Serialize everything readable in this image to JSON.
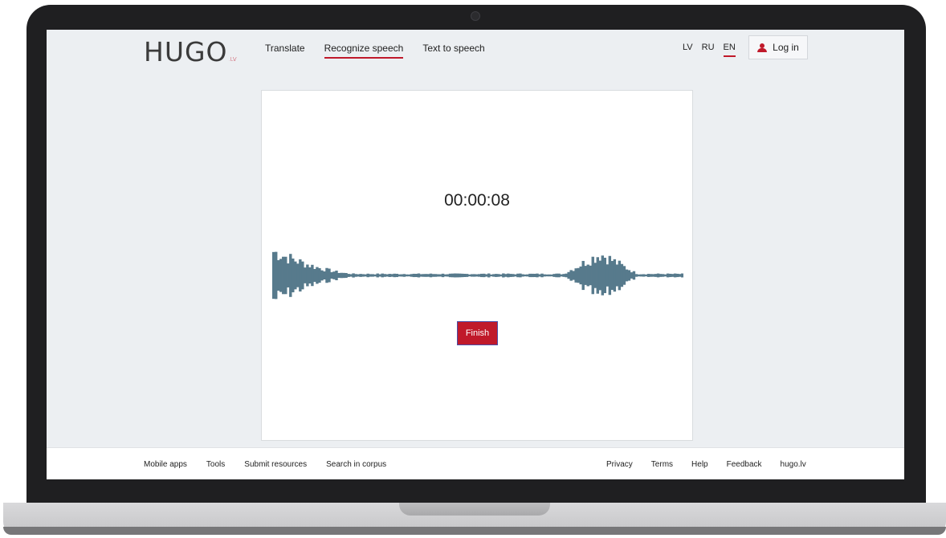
{
  "header": {
    "logo_main": "HUGO",
    "logo_sub": ".LV",
    "nav": [
      "Translate",
      "Recognize speech",
      "Text to speech"
    ],
    "active_nav": "Recognize speech",
    "languages": [
      "LV",
      "RU",
      "EN"
    ],
    "active_language": "EN",
    "login_label": "Log in"
  },
  "recorder": {
    "elapsed": "00:00:08",
    "finish_label": "Finish"
  },
  "footer": {
    "left_links": [
      "Mobile apps",
      "Tools",
      "Submit resources",
      "Search in corpus"
    ],
    "right_links": [
      "Privacy",
      "Terms",
      "Help",
      "Feedback",
      "hugo.lv"
    ]
  },
  "colors": {
    "accent": "#c0192a",
    "waveform": "#577a8c",
    "screen_bg": "#eceff2"
  },
  "icons": {
    "login": "user-icon"
  }
}
